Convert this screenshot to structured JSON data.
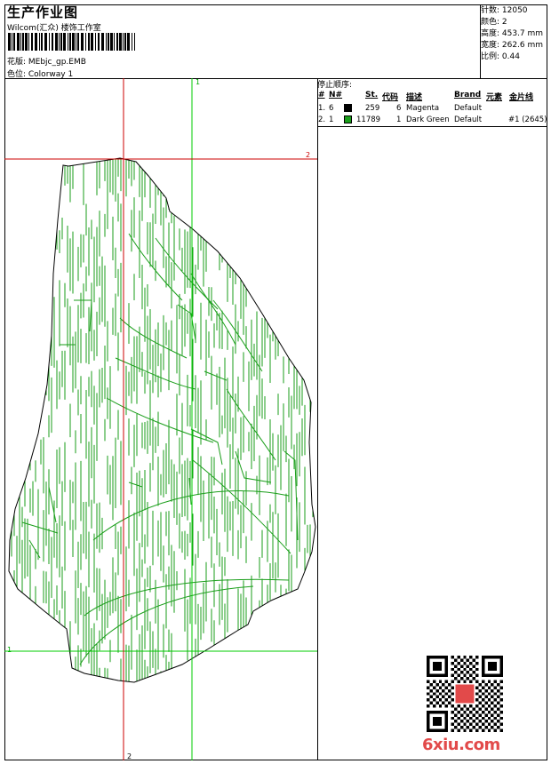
{
  "header": {
    "title": "生产作业图",
    "subtitle": "Wilcom(汇众) 楼饰工作室",
    "design_label": "花版: MEbjc_gp.EMB",
    "colorway_label": "色位: Colorway 1"
  },
  "stats": [
    {
      "label": "针数: 12050"
    },
    {
      "label": "颜色: 2"
    },
    {
      "label": "高度: 453.7 mm"
    },
    {
      "label": "宽度: 262.6 mm"
    },
    {
      "label": "比例: 0.44"
    }
  ],
  "stop_sequence": {
    "title": "停止顺序:",
    "headers": [
      "#",
      "N#",
      "St.",
      "代码",
      "描述",
      "Brand",
      "元素",
      "金片线"
    ],
    "rows": [
      {
        "idx": "1.",
        "n": "6",
        "color": "#000000",
        "st": "259",
        "code": "6",
        "desc": "Magenta",
        "brand": "Default",
        "elem": "",
        "sequin": ""
      },
      {
        "idx": "2.",
        "n": "1",
        "color": "#1a9e1a",
        "st": "11789",
        "code": "1",
        "desc": "Dark Green",
        "brand": "Default",
        "elem": "",
        "sequin": "#1 (2645)"
      }
    ]
  },
  "guides": {
    "green_label_top": "1",
    "green_label_left": "1",
    "red_label_right": "2",
    "red_label_bottom": "2"
  },
  "watermark": "6xiu.com",
  "colors": {
    "stitch_green": "#1a9e1a",
    "guide_red": "#cc0000",
    "guide_green": "#00cc00",
    "watermark": "#e24a4a"
  }
}
